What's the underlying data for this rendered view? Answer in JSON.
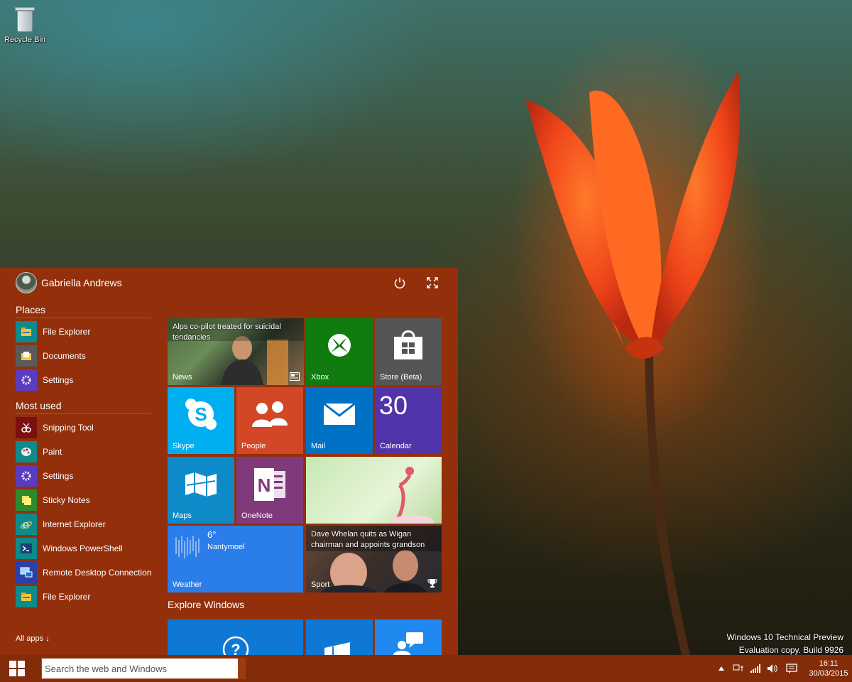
{
  "desktop": {
    "recycle_bin_label": "Recycle Bin",
    "watermark_line1": "Windows 10 Technical Preview",
    "watermark_line2": "Evaluation copy. Build 9926"
  },
  "start_menu": {
    "user_name": "Gabriella Andrews",
    "places_heading": "Places",
    "places": [
      {
        "label": "File Explorer",
        "icon": "file-explorer-icon",
        "color": "#0e8a8a"
      },
      {
        "label": "Documents",
        "icon": "documents-icon",
        "color": "#5a5a5a"
      },
      {
        "label": "Settings",
        "icon": "settings-icon",
        "color": "#5a3dbf"
      }
    ],
    "most_used_heading": "Most used",
    "most_used": [
      {
        "label": "Snipping Tool",
        "icon": "snipping-tool-icon",
        "color": "#7a1010"
      },
      {
        "label": "Paint",
        "icon": "paint-icon",
        "color": "#0e8a8a"
      },
      {
        "label": "Settings",
        "icon": "settings-icon",
        "color": "#5a3dbf"
      },
      {
        "label": "Sticky Notes",
        "icon": "sticky-notes-icon",
        "color": "#2d8a2d"
      },
      {
        "label": "Internet Explorer",
        "icon": "internet-explorer-icon",
        "color": "#0e8a8a"
      },
      {
        "label": "Windows PowerShell",
        "icon": "powershell-icon",
        "color": "#0e8a8a"
      },
      {
        "label": "Remote Desktop Connection",
        "icon": "remote-desktop-icon",
        "color": "#2a3fa8"
      },
      {
        "label": "File Explorer",
        "icon": "file-explorer-icon",
        "color": "#0e8a8a"
      }
    ],
    "all_apps": "All apps ↓",
    "explore_heading": "Explore Windows",
    "tiles": {
      "news": {
        "headline": "Alps co-pilot treated for suicidal tendancies",
        "label": "News"
      },
      "xbox": {
        "label": "Xbox",
        "color": "#107c10"
      },
      "store": {
        "label": "Store (Beta)",
        "color": "#555555"
      },
      "skype": {
        "label": "Skype",
        "color": "#00aff0"
      },
      "people": {
        "label": "People",
        "color": "#d24726"
      },
      "mail": {
        "label": "Mail",
        "color": "#0072c6"
      },
      "calendar": {
        "label": "Calendar",
        "date": "30",
        "color": "#5133ab"
      },
      "maps": {
        "label": "Maps",
        "color": "#0f8ac9"
      },
      "onenote": {
        "label": "OneNote",
        "color": "#80397b"
      },
      "weather": {
        "label": "Weather",
        "temp": "6°",
        "location": "Nantymoel",
        "color": "#2b7de9"
      },
      "sport": {
        "headline": "Dave Whelan quits as Wigan chairman and appoints grandson",
        "label": "Sport"
      }
    }
  },
  "taskbar": {
    "search_placeholder": "Search the web and Windows",
    "time": "16:11",
    "date": "30/03/2015"
  }
}
